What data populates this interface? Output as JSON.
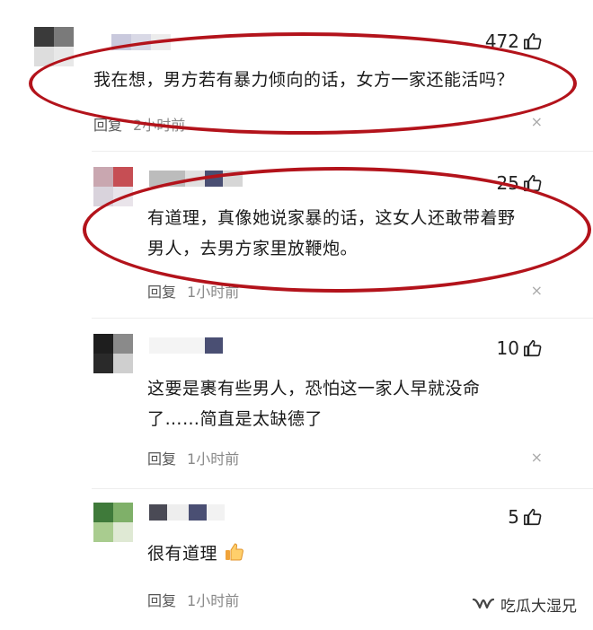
{
  "comments": [
    {
      "likes": "472",
      "text_lines": [
        "我在想，男方若有暴力倾向的话，女方一家还能活吗？"
      ],
      "reply_label": "回复",
      "time": "2小时前"
    },
    {
      "likes": "25",
      "text_lines": [
        "有道理，真像她说家暴的话，这女人还敢带着野",
        "男人，去男方家里放鞭炮。"
      ],
      "reply_label": "回复",
      "time": "1小时前"
    },
    {
      "likes": "10",
      "text_lines": [
        "这要是裹有些男人，恐怕这一家人早就没命",
        "了……简直是太缺德了"
      ],
      "reply_label": "回复",
      "time": "1小时前"
    },
    {
      "likes": "5",
      "text_lines": [
        "很有道理"
      ],
      "reply_label": "回复",
      "time": "1小时前",
      "emoji": "thumbs-up-emoji"
    }
  ],
  "close_glyph": "×",
  "watermark": {
    "text": "吃瓜大湿兄",
    "icon": "wechat-channel-icon"
  },
  "colors": {
    "highlight": "#b3131b",
    "like": "#222222",
    "meta": "#555555"
  }
}
